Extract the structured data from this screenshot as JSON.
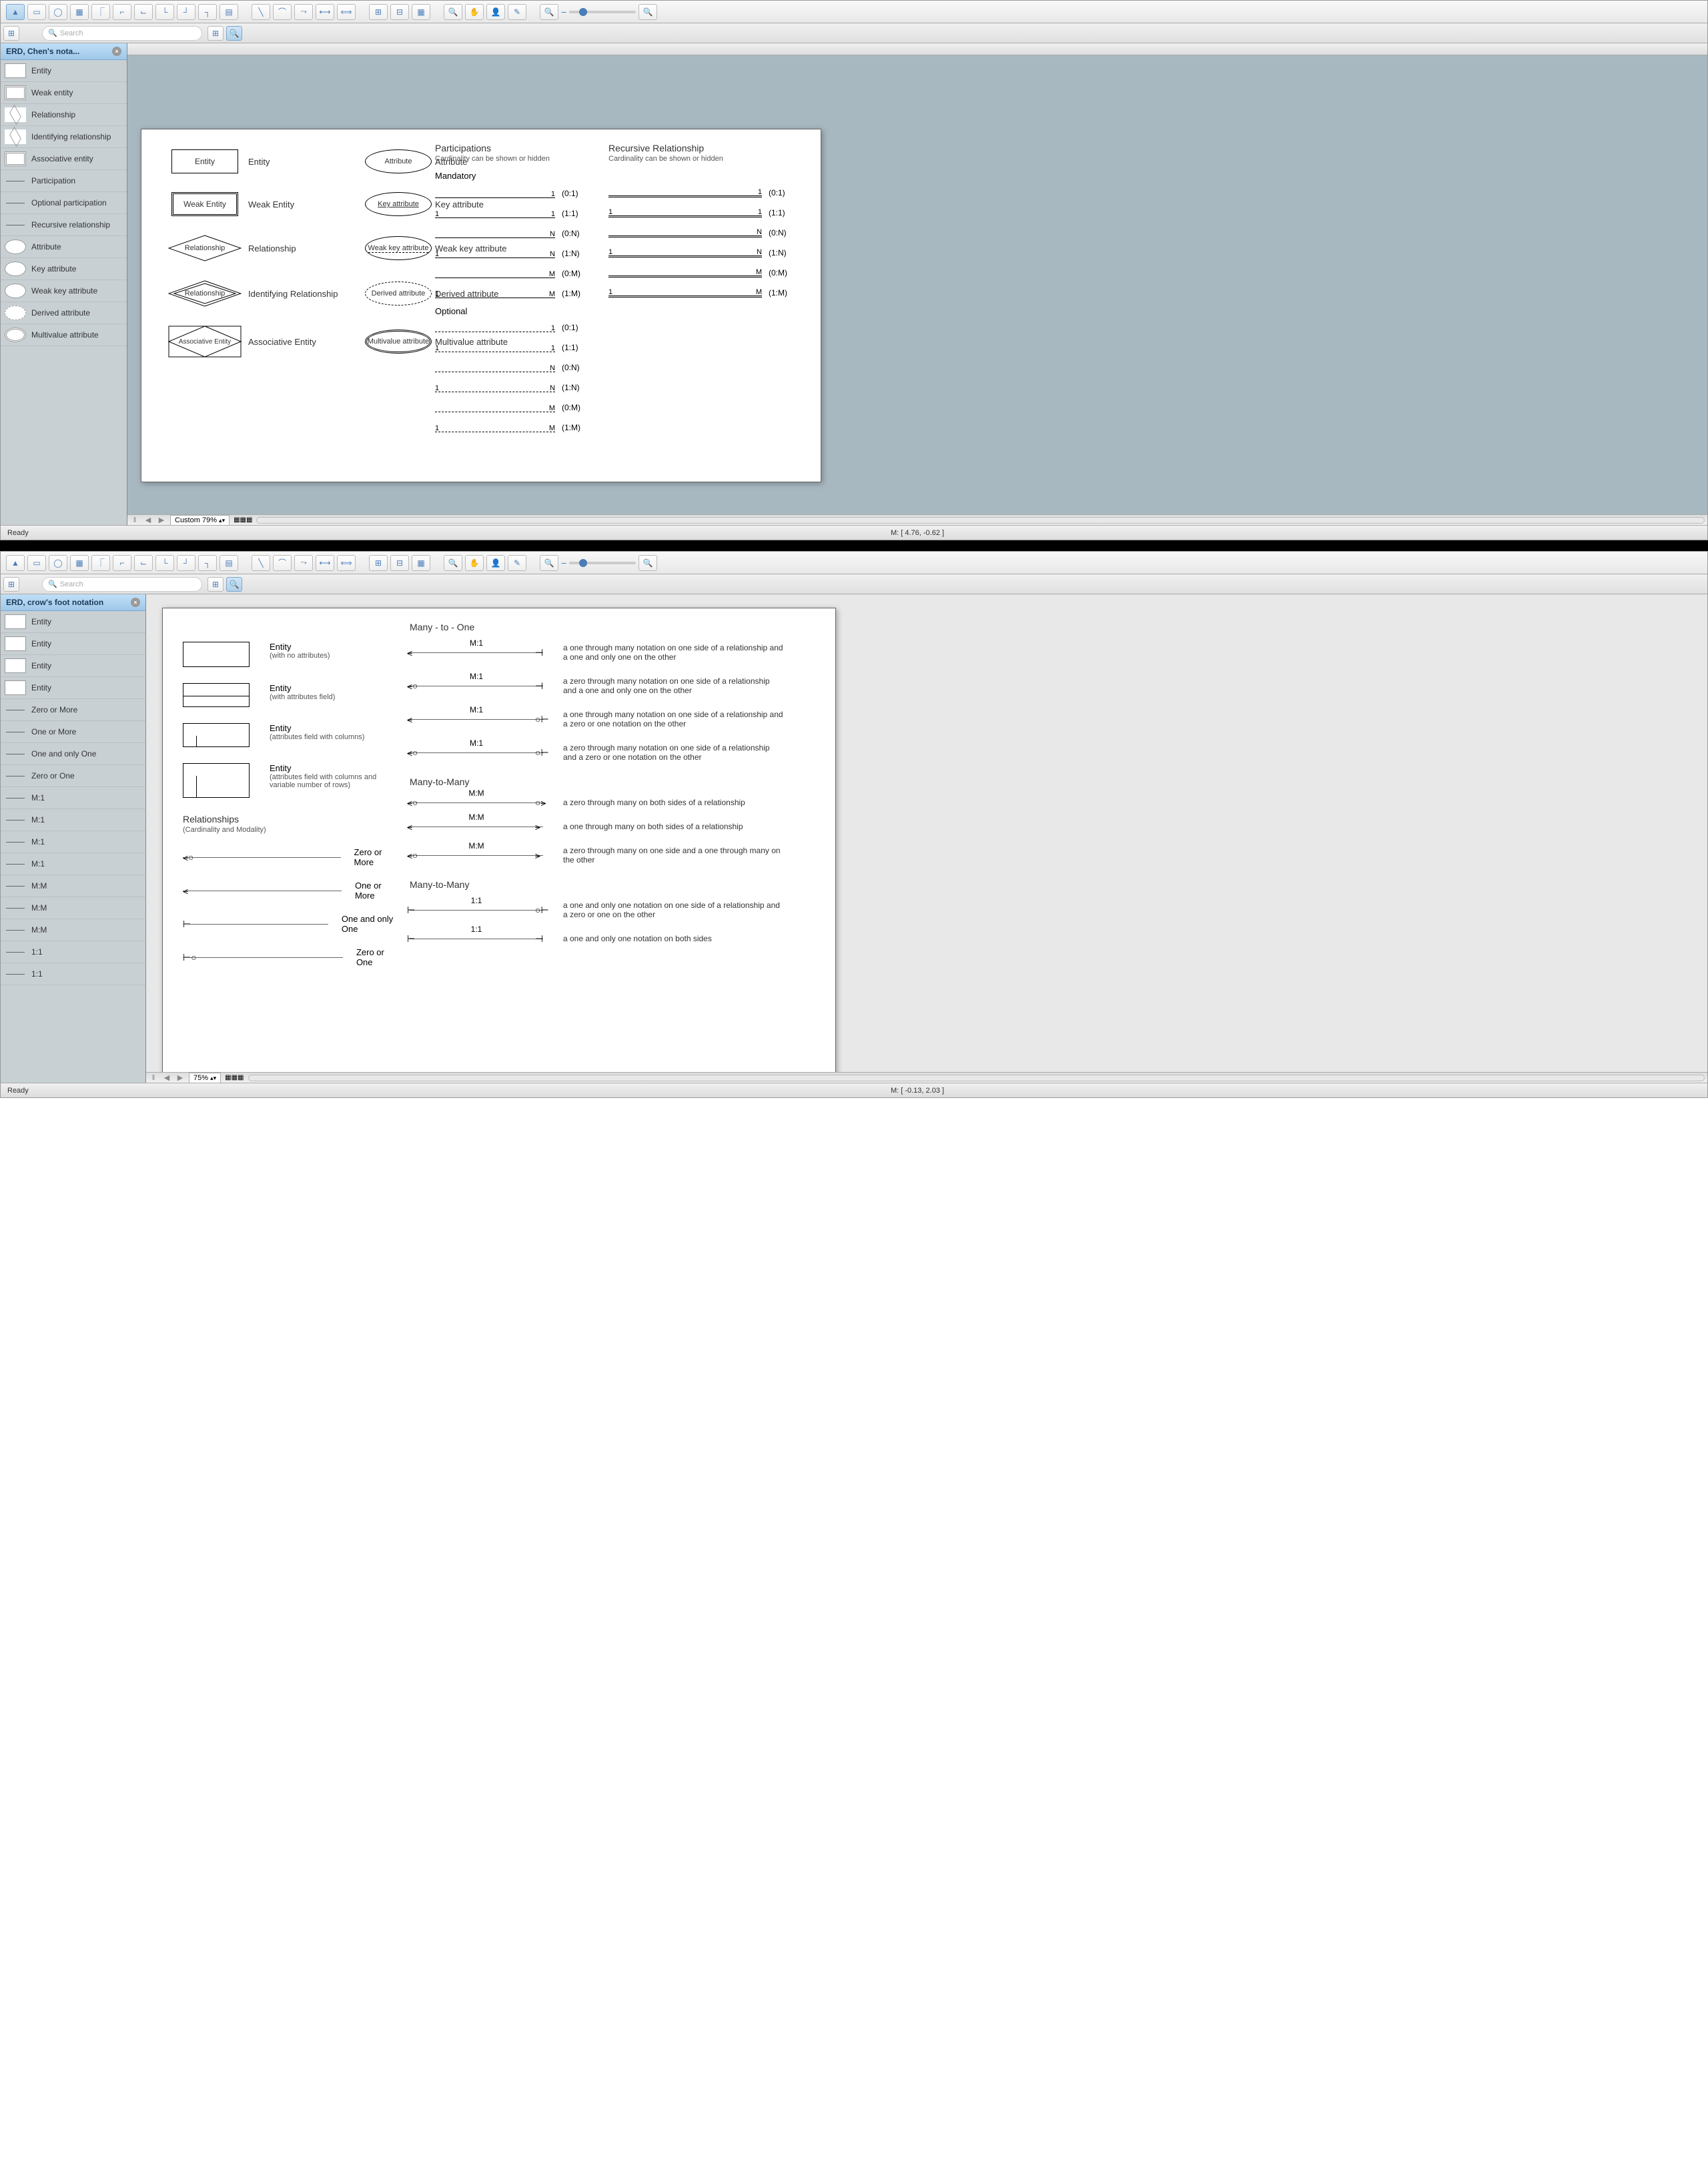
{
  "app1": {
    "search_placeholder": "Search",
    "sidebar": {
      "title": "ERD, Chen's nota...",
      "items": [
        "Entity",
        "Weak entity",
        "Relationship",
        "Identifying relationship",
        "Associative entity",
        "Participation",
        "Optional participation",
        "Recursive relationship",
        "Attribute",
        "Key attribute",
        "Weak key attribute",
        "Derived attribute",
        "Multivalue attribute"
      ]
    },
    "diagram": {
      "shapes": [
        {
          "shape": "Entity",
          "label": "Entity",
          "attr_shape": "Attribute",
          "attr_label": "Attribute"
        },
        {
          "shape": "Weak Entity",
          "label": "Weak Entity",
          "attr_shape": "Key attribute",
          "attr_label": "Key attribute"
        },
        {
          "shape": "Relationship",
          "label": "Relationship",
          "attr_shape": "Weak key attribute",
          "attr_label": "Weak key attribute"
        },
        {
          "shape": "Relationship",
          "label": "Identifying Relationship",
          "attr_shape": "Derived attribute",
          "attr_label": "Derived attribute"
        },
        {
          "shape": "Associative Entity",
          "label": "Associative Entity",
          "attr_shape": "Multivalue attribute",
          "attr_label": "Multivalue attribute"
        }
      ],
      "participations_title": "Participations",
      "participations_sub": "Cardinality can be shown or hidden",
      "recursive_title": "Recursive Relationship",
      "recursive_sub": "Cardinality can be shown or hidden",
      "mandatory_label": "Mandatory",
      "optional_label": "Optional",
      "part_lines": [
        {
          "l": "",
          "r": "1",
          "ratio": "(0:1)"
        },
        {
          "l": "1",
          "r": "1",
          "ratio": "(1:1)"
        },
        {
          "l": "",
          "r": "N",
          "ratio": "(0:N)"
        },
        {
          "l": "1",
          "r": "N",
          "ratio": "(1:N)"
        },
        {
          "l": "",
          "r": "M",
          "ratio": "(0:M)"
        },
        {
          "l": "1",
          "r": "M",
          "ratio": "(1:M)"
        }
      ],
      "opt_lines": [
        {
          "l": "",
          "r": "1",
          "ratio": "(0:1)"
        },
        {
          "l": "1",
          "r": "1",
          "ratio": "(1:1)"
        },
        {
          "l": "",
          "r": "N",
          "ratio": "(0:N)"
        },
        {
          "l": "1",
          "r": "N",
          "ratio": "(1:N)"
        },
        {
          "l": "",
          "r": "M",
          "ratio": "(0:M)"
        },
        {
          "l": "1",
          "r": "M",
          "ratio": "(1:M)"
        }
      ]
    },
    "status": {
      "ready": "Ready",
      "zoom": "Custom 79%",
      "coords": "M: [ 4.76, -0.62 ]"
    }
  },
  "app2": {
    "search_placeholder": "Search",
    "sidebar": {
      "title": "ERD, crow's foot notation",
      "items": [
        "Entity",
        "Entity",
        "Entity",
        "Entity",
        "Zero or More",
        "One or More",
        "One and only One",
        "Zero or One",
        "M:1",
        "M:1",
        "M:1",
        "M:1",
        "M:M",
        "M:M",
        "M:M",
        "1:1",
        "1:1"
      ]
    },
    "diagram": {
      "entities": [
        {
          "name": "Entity",
          "sub": "(with no attributes)"
        },
        {
          "name": "Entity",
          "sub": "(with attributes field)"
        },
        {
          "name": "Entity",
          "sub": "(attributes field with columns)"
        },
        {
          "name": "Entity",
          "sub": "(attributes field with columns and variable number of rows)"
        }
      ],
      "rel_header": "Relationships",
      "rel_sub": "(Cardinality and Modality)",
      "simple_rels": [
        "Zero or More",
        "One or More",
        "One and only One",
        "Zero or One"
      ],
      "m1_title": "Many - to - One",
      "m1": [
        {
          "mid": "M:1",
          "desc": "a one through many notation on one side of a relationship and a one and only one on the other"
        },
        {
          "mid": "M:1",
          "desc": "a zero through many notation on one side of a relationship and a one and only one on the other"
        },
        {
          "mid": "M:1",
          "desc": "a one through many notation on one side of a relationship and a zero or one notation on the other"
        },
        {
          "mid": "M:1",
          "desc": "a zero through many notation on one side of a relationship and a zero or one notation on the other"
        }
      ],
      "mm_title": "Many-to-Many",
      "mm": [
        {
          "mid": "M:M",
          "desc": "a zero through many on both sides of a relationship"
        },
        {
          "mid": "M:M",
          "desc": "a one through many on both sides of a relationship"
        },
        {
          "mid": "M:M",
          "desc": "a zero through many on one side and a one through many on the other"
        }
      ],
      "oo_title": "Many-to-Many",
      "oo": [
        {
          "mid": "1:1",
          "desc": "a one and only one notation on one side of a relationship and a zero or one on the other"
        },
        {
          "mid": "1:1",
          "desc": "a one and only one notation on both sides"
        }
      ]
    },
    "status": {
      "ready": "Ready",
      "zoom": "75%",
      "coords": "M: [ -0.13, 2.03 ]"
    }
  }
}
